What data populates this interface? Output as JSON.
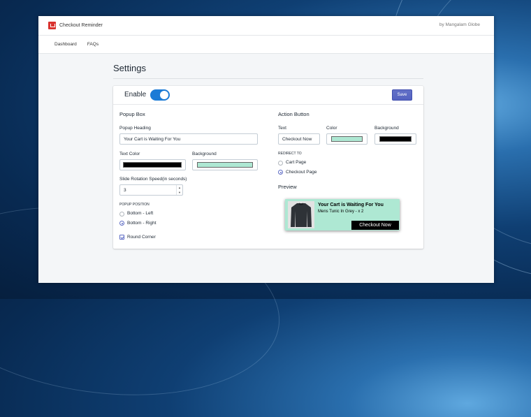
{
  "app": {
    "title": "Checkout Reminder",
    "byline": "by Mangalam Globe"
  },
  "nav": [
    {
      "label": "Dashboard"
    },
    {
      "label": "FAQs"
    }
  ],
  "page": {
    "title": "Settings"
  },
  "header": {
    "enable_label": "Enable",
    "enabled": true,
    "save_label": "Save"
  },
  "popup": {
    "section_title": "Popup Box",
    "heading_label": "Popup Heading",
    "heading_value": "Your Cart is Waiting For You",
    "text_color_label": "Text Color",
    "text_color": "#000000",
    "background_label": "Background",
    "background_color": "#aee8d3",
    "speed_label": "Slide Rotation Speed(in seconds)",
    "speed_value": "3",
    "position_label": "POPUP POSITION",
    "positions": [
      {
        "label": "Bottom - Left",
        "selected": false
      },
      {
        "label": "Bottom - Right",
        "selected": true
      }
    ],
    "round_corner_label": "Round Corner",
    "round_corner": true
  },
  "action": {
    "section_title": "Action Button",
    "text_label": "Text",
    "text_value": "Checkout Now",
    "color_label": "Color",
    "color": "#aee8d3",
    "background_label": "Background",
    "background_color": "#000000",
    "redirect_label": "REDIRECT TO",
    "redirects": [
      {
        "label": "Cart Page",
        "selected": false
      },
      {
        "label": "Checkout Page",
        "selected": true
      }
    ]
  },
  "preview": {
    "label": "Preview",
    "heading": "Your Cart is Waiting For You",
    "subtitle": "Mens Tunic In Grey - x 2",
    "button": "Checkout Now"
  }
}
